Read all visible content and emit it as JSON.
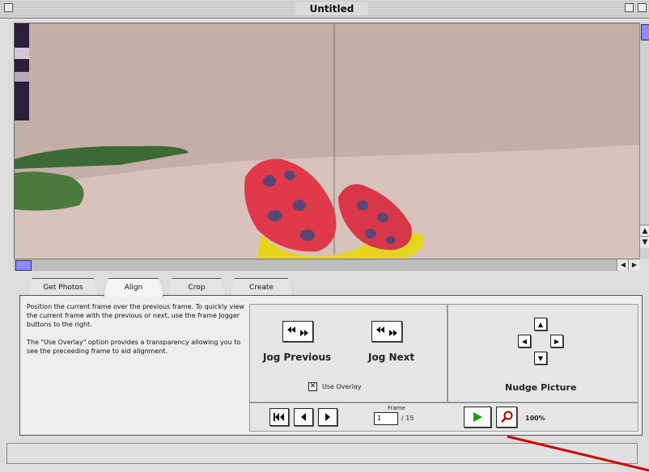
{
  "window": {
    "title": "Untitled"
  },
  "tabs": [
    {
      "label": "Get Photos"
    },
    {
      "label": "Align"
    },
    {
      "label": "Crop"
    },
    {
      "label": "Create"
    }
  ],
  "help": {
    "paragraph1": "Position the current frame over the previous frame. To quickly view the current frame with the previous or next, use the frame Jogger buttons to the right.",
    "paragraph2": "The \"Use Overlay\" option provides a transparency allowing you to see the preceeding frame to aid alignment."
  },
  "jog": {
    "previous_label": "Jog Previous",
    "next_label": "Jog Next",
    "overlay_label": "Use Overlay",
    "overlay_checked": true
  },
  "nudge": {
    "label": "Nudge Picture"
  },
  "playback": {
    "frame_caption": "Frame",
    "frame_value": "1",
    "frame_total": "/ 15",
    "zoom": "100%"
  },
  "colors": {
    "accent": "#8c8cff",
    "play": "#1f9a1f",
    "zoom_icon": "#b00000",
    "annotation_arrow": "#cc0000"
  }
}
